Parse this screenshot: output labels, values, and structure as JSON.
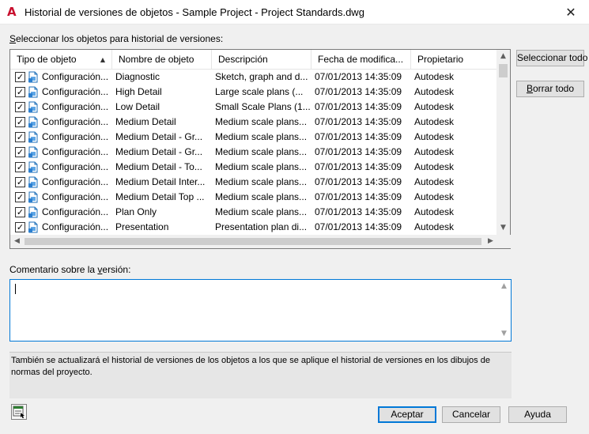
{
  "window": {
    "title": "Historial de versiones de objetos - Sample Project - Project Standards.dwg",
    "app_icon": "autodesk-a-icon",
    "close_glyph": "✕"
  },
  "select_label_prefix": "S",
  "select_label_rest": "eleccionar los objetos para historial de versiones:",
  "list": {
    "columns": [
      "Tipo de objeto",
      "Nombre de objeto",
      "Descripción",
      "Fecha de modifica...",
      "Propietario"
    ],
    "sort_glyph": "▲",
    "rows": [
      {
        "checked": true,
        "type": "Configuración...",
        "name": "Diagnostic",
        "description": "Sketch, graph and d...",
        "date": "07/01/2013 14:35:09",
        "owner": "Autodesk"
      },
      {
        "checked": true,
        "type": "Configuración...",
        "name": "High Detail",
        "description": "Large scale plans (...",
        "date": "07/01/2013 14:35:09",
        "owner": "Autodesk"
      },
      {
        "checked": true,
        "type": "Configuración...",
        "name": "Low Detail",
        "description": "Small Scale Plans (1...",
        "date": "07/01/2013 14:35:09",
        "owner": "Autodesk"
      },
      {
        "checked": true,
        "type": "Configuración...",
        "name": "Medium Detail",
        "description": "Medium scale plans...",
        "date": "07/01/2013 14:35:09",
        "owner": "Autodesk"
      },
      {
        "checked": true,
        "type": "Configuración...",
        "name": "Medium Detail - Gr...",
        "description": "Medium scale plans...",
        "date": "07/01/2013 14:35:09",
        "owner": "Autodesk"
      },
      {
        "checked": true,
        "type": "Configuración...",
        "name": "Medium Detail - Gr...",
        "description": "Medium scale plans...",
        "date": "07/01/2013 14:35:09",
        "owner": "Autodesk"
      },
      {
        "checked": true,
        "type": "Configuración...",
        "name": "Medium Detail - To...",
        "description": "Medium scale plans...",
        "date": "07/01/2013 14:35:09",
        "owner": "Autodesk"
      },
      {
        "checked": true,
        "type": "Configuración...",
        "name": "Medium Detail Inter...",
        "description": "Medium scale plans...",
        "date": "07/01/2013 14:35:09",
        "owner": "Autodesk"
      },
      {
        "checked": true,
        "type": "Configuración...",
        "name": "Medium Detail Top ...",
        "description": "Medium scale plans...",
        "date": "07/01/2013 14:35:09",
        "owner": "Autodesk"
      },
      {
        "checked": true,
        "type": "Configuración...",
        "name": "Plan Only",
        "description": "Medium scale plans...",
        "date": "07/01/2013 14:35:09",
        "owner": "Autodesk"
      },
      {
        "checked": true,
        "type": "Configuración...",
        "name": "Presentation",
        "description": "Presentation plan di...",
        "date": "07/01/2013 14:35:09",
        "owner": "Autodesk"
      }
    ]
  },
  "buttons": {
    "select_all": "Seleccionar todo",
    "clear_all_u": "B",
    "clear_all_rest": "orrar todo",
    "accept": "Aceptar",
    "cancel": "Cancelar",
    "help": "Ayuda"
  },
  "comment_label_prefix": "Comentario sobre la ",
  "comment_label_u": "v",
  "comment_label_rest": "ersión:",
  "comment_value": "",
  "info_text": "También se actualizará el historial de versiones de los objetos a los que se aplique el historial de versiones en los dibujos de normas del proyecto.",
  "colors": {
    "accent": "#0078d7",
    "brand": "#c8102e"
  }
}
